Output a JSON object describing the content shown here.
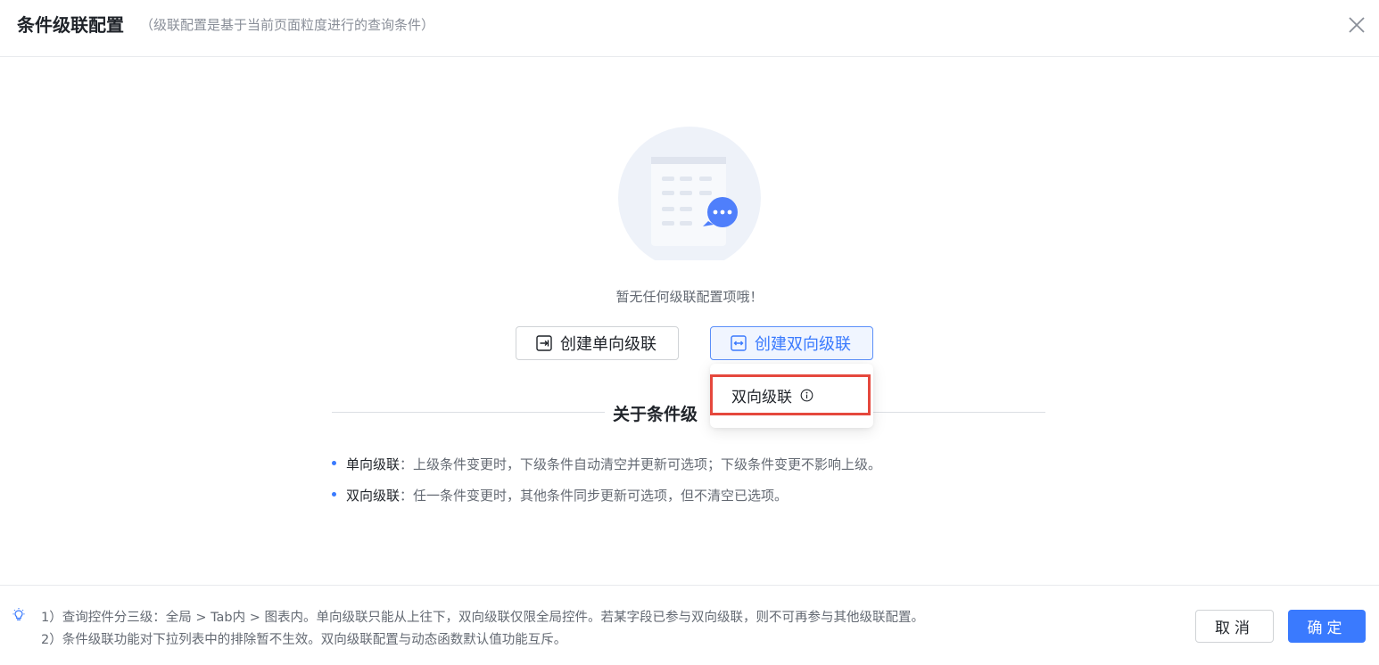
{
  "dialog": {
    "title": "条件级联配置",
    "subtitle": "（级联配置是基于当前页面粒度进行的查询条件）",
    "close_icon": "close-icon"
  },
  "empty_state": {
    "illustration_icon": "empty-list-chat-icon",
    "message": "暂无任何级联配置项哦！"
  },
  "actions": {
    "create_single": "创建单向级联",
    "create_single_icon": "arrow-right-box-icon",
    "create_double": "创建双向级联",
    "create_double_icon": "arrow-both-box-icon"
  },
  "dropdown": {
    "items": [
      {
        "label": "双向级联",
        "icon": "info-icon"
      }
    ]
  },
  "about": {
    "title": "关于条件级",
    "items": [
      {
        "term": "单向级联",
        "sep": "：",
        "text": "上级条件变更时，下级条件自动清空并更新可选项；下级条件变更不影响上级。"
      },
      {
        "term": "双向级联",
        "sep": "：",
        "text": "任一条件变更时，其他条件同步更新可选项，但不清空已选项。"
      }
    ]
  },
  "footer": {
    "tip_icon": "lightbulb-icon",
    "notes": [
      "1）查询控件分三级：全局 > Tab内 > 图表内。单向级联只能从上往下，双向级联仅限全局控件。若某字段已参与双向级联，则不可再参与其他级联配置。",
      "2）条件级联功能对下拉列表中的排除暂不生效。双向级联配置与动态函数默认值功能互斥。"
    ],
    "cancel_label": "取消",
    "confirm_label": "确定"
  },
  "colors": {
    "primary": "#3a7afe",
    "highlight_border": "#e5483d",
    "text_main": "#1f2329",
    "text_secondary": "#646a73"
  }
}
